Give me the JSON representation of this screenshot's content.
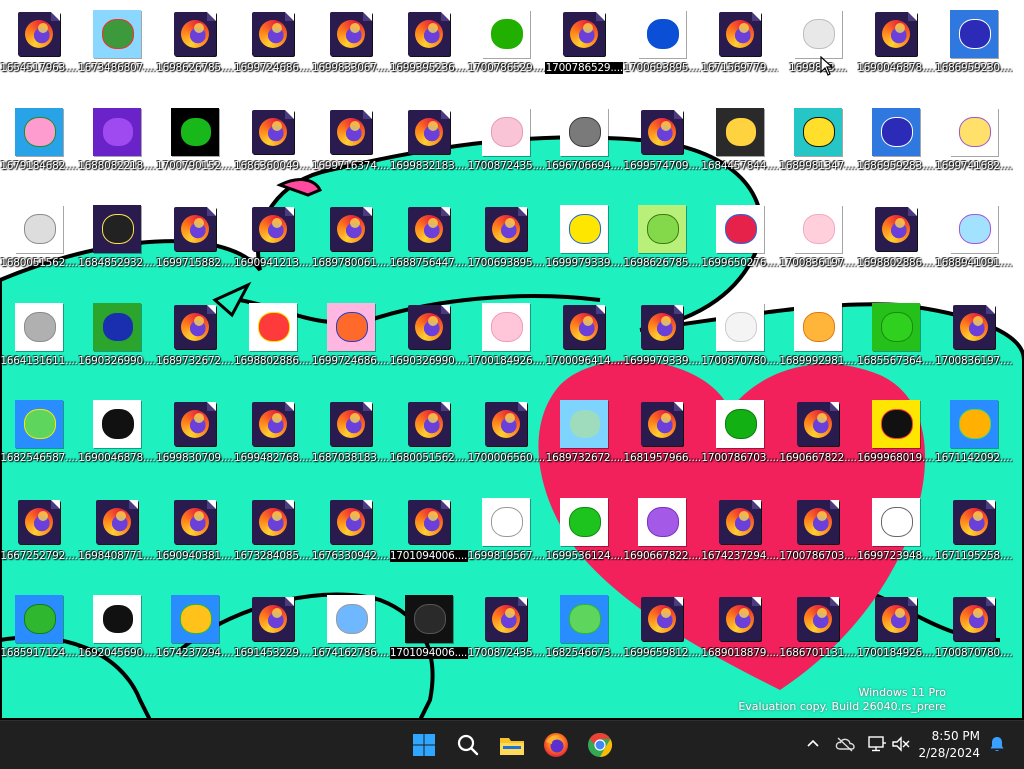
{
  "desktop": {
    "watermark_line1": "Windows 11 Pro",
    "watermark_line2": "Evaluation copy. Build 26040.rs_prere",
    "icons": [
      {
        "label": "1654517963....",
        "kind": "ff"
      },
      {
        "label": "1673486807....",
        "kind": "img",
        "c1": "#8ad7ff",
        "c2": "#3c9a3c",
        "c3": "#ff2a2a"
      },
      {
        "label": "1698626785....",
        "kind": "ff"
      },
      {
        "label": "1699724686....",
        "kind": "ff"
      },
      {
        "label": "1699833067....",
        "kind": "ff"
      },
      {
        "label": "1699395236....",
        "kind": "ff"
      },
      {
        "label": "1700786529....",
        "kind": "img",
        "c1": "#ffffff",
        "c2": "#22b000",
        "c3": "#22b000"
      },
      {
        "label": "1700786529....",
        "kind": "ff",
        "selected": true
      },
      {
        "label": "1700693895....",
        "kind": "img",
        "c1": "#ffffff",
        "c2": "#0a4fd6",
        "c3": "#0a4fd6"
      },
      {
        "label": "1671569779....",
        "kind": "ff"
      },
      {
        "label": "1699833....",
        "kind": "img",
        "c1": "#ffffff",
        "c2": "#e8e8e8",
        "c3": "#bdbdbd",
        "hover": true
      },
      {
        "label": "1690046878....",
        "kind": "ff"
      },
      {
        "label": "1686959230....",
        "kind": "img",
        "c1": "#2f78e0",
        "c2": "#2b2bb8",
        "c3": "#ffffff"
      },
      {
        "label": "1679184682....",
        "kind": "img",
        "c1": "#29a3e8",
        "c2": "#ff9ccf",
        "c3": "#1d8d2a"
      },
      {
        "label": "1688082218....",
        "kind": "img",
        "c1": "#6a23c9",
        "c2": "#9e4af0",
        "c3": "#6a23c9"
      },
      {
        "label": "1700790152....",
        "kind": "img",
        "c1": "#000000",
        "c2": "#18b81a",
        "c3": "#000000"
      },
      {
        "label": "1686360049....",
        "kind": "ff"
      },
      {
        "label": "1699716374....",
        "kind": "ff"
      },
      {
        "label": "1699832183....",
        "kind": "ff"
      },
      {
        "label": "1700872435....",
        "kind": "img",
        "c1": "#ffffff",
        "c2": "#f9c4d6",
        "c3": "#e89ab4"
      },
      {
        "label": "1696706694....",
        "kind": "img",
        "c1": "#ffffff",
        "c2": "#7a7a7a",
        "c3": "#3b3b3b"
      },
      {
        "label": "1699574709....",
        "kind": "ff"
      },
      {
        "label": "1684457844....",
        "kind": "img",
        "c1": "#2a2a2a",
        "c2": "#ffd23f",
        "c3": "#2a2a2a"
      },
      {
        "label": "1689981347....",
        "kind": "img",
        "c1": "#26c6c6",
        "c2": "#ffdf2a",
        "c3": "#111111"
      },
      {
        "label": "1686959283....",
        "kind": "img",
        "c1": "#2f78e0",
        "c2": "#2b2bb8",
        "c3": "#ffffff"
      },
      {
        "label": "1699741682....",
        "kind": "img",
        "c1": "#ffffff",
        "c2": "#ffe06a",
        "c3": "#9b59d0"
      },
      {
        "label": "1680051562....",
        "kind": "img",
        "c1": "#ffffff",
        "c2": "#dddddd",
        "c3": "#8c8c8c"
      },
      {
        "label": "1684852932....",
        "kind": "img",
        "c1": "#2a1b4f",
        "c2": "#222222",
        "c3": "#ffe34a"
      },
      {
        "label": "1699715882....",
        "kind": "ff"
      },
      {
        "label": "1690941213....",
        "kind": "ff"
      },
      {
        "label": "1689780061....",
        "kind": "ff"
      },
      {
        "label": "1688756447....",
        "kind": "ff"
      },
      {
        "label": "1700693895....",
        "kind": "ff"
      },
      {
        "label": "1699979339....",
        "kind": "img",
        "c1": "#ffffff",
        "c2": "#ffe600",
        "c3": "#1f63e0"
      },
      {
        "label": "1698626785....",
        "kind": "img",
        "c1": "#b9f07a",
        "c2": "#83d94a",
        "c3": "#3c7a12"
      },
      {
        "label": "1699650276....",
        "kind": "img",
        "c1": "#ffffff",
        "c2": "#e6224a",
        "c3": "#1e6ee8"
      },
      {
        "label": "1700836197....",
        "kind": "img",
        "c1": "#ffffff",
        "c2": "#ffd0dc",
        "c3": "#f3a9bf"
      },
      {
        "label": "1698802886....",
        "kind": "ff"
      },
      {
        "label": "1688941091....",
        "kind": "img",
        "c1": "#ffffff",
        "c2": "#a3e2ff",
        "c3": "#a354d8"
      },
      {
        "label": "1664131611....",
        "kind": "img",
        "c1": "#ffffff",
        "c2": "#b0b0b0",
        "c3": "#8a8a8a"
      },
      {
        "label": "1690326990....",
        "kind": "img",
        "c1": "#2ba52b",
        "c2": "#1a2fb0",
        "c3": "#2ba52b"
      },
      {
        "label": "1689732672....",
        "kind": "ff"
      },
      {
        "label": "1698802886....",
        "kind": "img",
        "c1": "#ffffff",
        "c2": "#ff3a3a",
        "c3": "#ffe600"
      },
      {
        "label": "1699724686....",
        "kind": "img",
        "c1": "#ffb6e0",
        "c2": "#ff6a2a",
        "c3": "#1e3fd1"
      },
      {
        "label": "1690326990....",
        "kind": "ff"
      },
      {
        "label": "1700184926....",
        "kind": "img",
        "c1": "#ffffff",
        "c2": "#ffc6da",
        "c3": "#f09ab7"
      },
      {
        "label": "1700096414....",
        "kind": "ff"
      },
      {
        "label": "1699979339....",
        "kind": "ff"
      },
      {
        "label": "1700870780....",
        "kind": "img",
        "c1": "#ffffff",
        "c2": "#f4f4f4",
        "c3": "#cccccc"
      },
      {
        "label": "1689992981....",
        "kind": "img",
        "c1": "#ffffff",
        "c2": "#ffb43a",
        "c3": "#e07a10"
      },
      {
        "label": "1685567364....",
        "kind": "img",
        "c1": "#26c01a",
        "c2": "#2fd11e",
        "c3": "#1a8a10"
      },
      {
        "label": "1700836197....",
        "kind": "ff"
      },
      {
        "label": "1682546587....",
        "kind": "img",
        "c1": "#2a8dff",
        "c2": "#5ed65e",
        "c3": "#ffe600"
      },
      {
        "label": "1690046878....",
        "kind": "img",
        "c1": "#ffffff",
        "c2": "#111111",
        "c3": "#111111"
      },
      {
        "label": "1699830709....",
        "kind": "ff"
      },
      {
        "label": "1699482768....",
        "kind": "ff"
      },
      {
        "label": "1687038183....",
        "kind": "ff"
      },
      {
        "label": "1680051562....",
        "kind": "ff"
      },
      {
        "label": "1700006560....",
        "kind": "ff"
      },
      {
        "label": "1689732672....",
        "kind": "img",
        "c1": "#7fd3ff",
        "c2": "#9fdcbe",
        "c3": "#7fd3ff"
      },
      {
        "label": "1681957966....",
        "kind": "ff"
      },
      {
        "label": "1700786703....",
        "kind": "img",
        "c1": "#ffffff",
        "c2": "#12b012",
        "c3": "#0e7a0e"
      },
      {
        "label": "1690667822....",
        "kind": "ff"
      },
      {
        "label": "1699968019....",
        "kind": "img",
        "c1": "#ffe600",
        "c2": "#111111",
        "c3": "#ff3a3a"
      },
      {
        "label": "1671142092....",
        "kind": "img",
        "c1": "#2a8dff",
        "c2": "#ffb000",
        "c3": "#5ed65e"
      },
      {
        "label": "1667252792....",
        "kind": "ff"
      },
      {
        "label": "1698408771....",
        "kind": "ff"
      },
      {
        "label": "1690940381....",
        "kind": "ff"
      },
      {
        "label": "1673284085....",
        "kind": "ff"
      },
      {
        "label": "1676330942....",
        "kind": "ff"
      },
      {
        "label": "1701094006....",
        "kind": "ff",
        "selected": true
      },
      {
        "label": "1699819567....",
        "kind": "img",
        "c1": "#ffffff",
        "c2": "#ffffff",
        "c3": "#999999"
      },
      {
        "label": "1699536124....",
        "kind": "img",
        "c1": "#ffffff",
        "c2": "#1ec41e",
        "c3": "#0e8a0e"
      },
      {
        "label": "1690667822....",
        "kind": "img",
        "c1": "#ffffff",
        "c2": "#a45ae6",
        "c3": "#7a32c4"
      },
      {
        "label": "1674237294....",
        "kind": "ff"
      },
      {
        "label": "1700786703....",
        "kind": "ff"
      },
      {
        "label": "1699723948....",
        "kind": "img",
        "c1": "#ffffff",
        "c2": "#ffffff",
        "c3": "#666666"
      },
      {
        "label": "1671195258....",
        "kind": "ff"
      },
      {
        "label": "1685917124....",
        "kind": "img",
        "c1": "#2a8dff",
        "c2": "#2fb82f",
        "c3": "#1a7a1a"
      },
      {
        "label": "1692045690....",
        "kind": "img",
        "c1": "#ffffff",
        "c2": "#111111",
        "c3": "#ffffff"
      },
      {
        "label": "1674237294....",
        "kind": "img",
        "c1": "#2a8dff",
        "c2": "#ffc21a",
        "c3": "#2fb82f"
      },
      {
        "label": "1691453229....",
        "kind": "ff"
      },
      {
        "label": "1674162786....",
        "kind": "img",
        "c1": "#ffffff",
        "c2": "#6fb8ff",
        "c3": "#9a9a9a"
      },
      {
        "label": "1701094006....",
        "kind": "img",
        "c1": "#111111",
        "c2": "#2a2a2a",
        "c3": "#555555",
        "selected": true
      },
      {
        "label": "1700872435....",
        "kind": "ff"
      },
      {
        "label": "1682546673....",
        "kind": "img",
        "c1": "#2a8dff",
        "c2": "#5ed65e",
        "c3": "#2fb82f"
      },
      {
        "label": "1699659812....",
        "kind": "ff"
      },
      {
        "label": "1689018879....",
        "kind": "ff"
      },
      {
        "label": "1686701131....",
        "kind": "ff"
      },
      {
        "label": "1700184926....",
        "kind": "ff"
      },
      {
        "label": "1700870780....",
        "kind": "ff"
      }
    ]
  },
  "taskbar": {
    "items": [
      {
        "name": "start-button",
        "icon": "windows-logo-icon"
      },
      {
        "name": "search-button",
        "icon": "search-icon"
      },
      {
        "name": "file-explorer-button",
        "icon": "folder-icon"
      },
      {
        "name": "firefox-button",
        "icon": "firefox-icon"
      },
      {
        "name": "chrome-button",
        "icon": "chrome-icon"
      }
    ],
    "tray": [
      "chevron-up-icon",
      "cloud-offline-icon",
      "network-icon",
      "volume-muted-icon"
    ],
    "time": "8:50 PM",
    "date": "2/28/2024",
    "notification_icon": "bell-icon"
  },
  "colors": {
    "wallpaper_bg": "#ffffff",
    "creature": "#1ef0c0",
    "heart": "#f2215b",
    "taskbar": "#202020"
  }
}
